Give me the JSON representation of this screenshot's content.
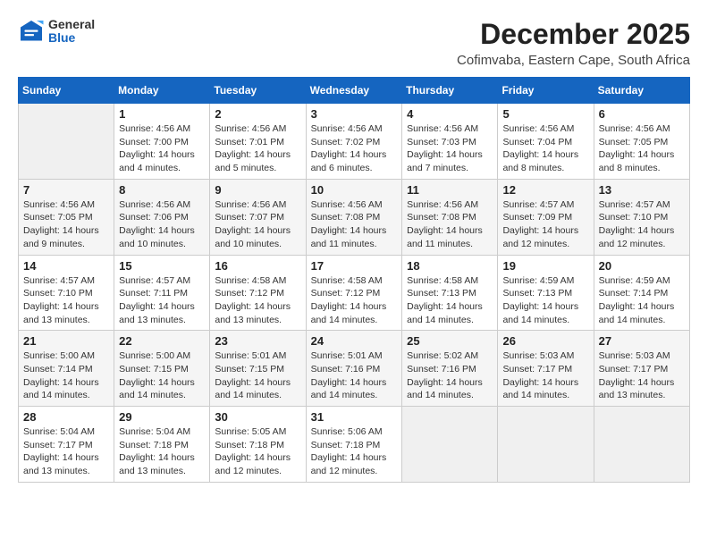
{
  "header": {
    "logo_general": "General",
    "logo_blue": "Blue",
    "title": "December 2025",
    "subtitle": "Cofimvaba, Eastern Cape, South Africa"
  },
  "calendar": {
    "columns": [
      "Sunday",
      "Monday",
      "Tuesday",
      "Wednesday",
      "Thursday",
      "Friday",
      "Saturday"
    ],
    "weeks": [
      [
        {
          "num": "",
          "info": ""
        },
        {
          "num": "1",
          "info": "Sunrise: 4:56 AM\nSunset: 7:00 PM\nDaylight: 14 hours\nand 4 minutes."
        },
        {
          "num": "2",
          "info": "Sunrise: 4:56 AM\nSunset: 7:01 PM\nDaylight: 14 hours\nand 5 minutes."
        },
        {
          "num": "3",
          "info": "Sunrise: 4:56 AM\nSunset: 7:02 PM\nDaylight: 14 hours\nand 6 minutes."
        },
        {
          "num": "4",
          "info": "Sunrise: 4:56 AM\nSunset: 7:03 PM\nDaylight: 14 hours\nand 7 minutes."
        },
        {
          "num": "5",
          "info": "Sunrise: 4:56 AM\nSunset: 7:04 PM\nDaylight: 14 hours\nand 8 minutes."
        },
        {
          "num": "6",
          "info": "Sunrise: 4:56 AM\nSunset: 7:05 PM\nDaylight: 14 hours\nand 8 minutes."
        }
      ],
      [
        {
          "num": "7",
          "info": "Sunrise: 4:56 AM\nSunset: 7:05 PM\nDaylight: 14 hours\nand 9 minutes."
        },
        {
          "num": "8",
          "info": "Sunrise: 4:56 AM\nSunset: 7:06 PM\nDaylight: 14 hours\nand 10 minutes."
        },
        {
          "num": "9",
          "info": "Sunrise: 4:56 AM\nSunset: 7:07 PM\nDaylight: 14 hours\nand 10 minutes."
        },
        {
          "num": "10",
          "info": "Sunrise: 4:56 AM\nSunset: 7:08 PM\nDaylight: 14 hours\nand 11 minutes."
        },
        {
          "num": "11",
          "info": "Sunrise: 4:56 AM\nSunset: 7:08 PM\nDaylight: 14 hours\nand 11 minutes."
        },
        {
          "num": "12",
          "info": "Sunrise: 4:57 AM\nSunset: 7:09 PM\nDaylight: 14 hours\nand 12 minutes."
        },
        {
          "num": "13",
          "info": "Sunrise: 4:57 AM\nSunset: 7:10 PM\nDaylight: 14 hours\nand 12 minutes."
        }
      ],
      [
        {
          "num": "14",
          "info": "Sunrise: 4:57 AM\nSunset: 7:10 PM\nDaylight: 14 hours\nand 13 minutes."
        },
        {
          "num": "15",
          "info": "Sunrise: 4:57 AM\nSunset: 7:11 PM\nDaylight: 14 hours\nand 13 minutes."
        },
        {
          "num": "16",
          "info": "Sunrise: 4:58 AM\nSunset: 7:12 PM\nDaylight: 14 hours\nand 13 minutes."
        },
        {
          "num": "17",
          "info": "Sunrise: 4:58 AM\nSunset: 7:12 PM\nDaylight: 14 hours\nand 14 minutes."
        },
        {
          "num": "18",
          "info": "Sunrise: 4:58 AM\nSunset: 7:13 PM\nDaylight: 14 hours\nand 14 minutes."
        },
        {
          "num": "19",
          "info": "Sunrise: 4:59 AM\nSunset: 7:13 PM\nDaylight: 14 hours\nand 14 minutes."
        },
        {
          "num": "20",
          "info": "Sunrise: 4:59 AM\nSunset: 7:14 PM\nDaylight: 14 hours\nand 14 minutes."
        }
      ],
      [
        {
          "num": "21",
          "info": "Sunrise: 5:00 AM\nSunset: 7:14 PM\nDaylight: 14 hours\nand 14 minutes."
        },
        {
          "num": "22",
          "info": "Sunrise: 5:00 AM\nSunset: 7:15 PM\nDaylight: 14 hours\nand 14 minutes."
        },
        {
          "num": "23",
          "info": "Sunrise: 5:01 AM\nSunset: 7:15 PM\nDaylight: 14 hours\nand 14 minutes."
        },
        {
          "num": "24",
          "info": "Sunrise: 5:01 AM\nSunset: 7:16 PM\nDaylight: 14 hours\nand 14 minutes."
        },
        {
          "num": "25",
          "info": "Sunrise: 5:02 AM\nSunset: 7:16 PM\nDaylight: 14 hours\nand 14 minutes."
        },
        {
          "num": "26",
          "info": "Sunrise: 5:03 AM\nSunset: 7:17 PM\nDaylight: 14 hours\nand 14 minutes."
        },
        {
          "num": "27",
          "info": "Sunrise: 5:03 AM\nSunset: 7:17 PM\nDaylight: 14 hours\nand 13 minutes."
        }
      ],
      [
        {
          "num": "28",
          "info": "Sunrise: 5:04 AM\nSunset: 7:17 PM\nDaylight: 14 hours\nand 13 minutes."
        },
        {
          "num": "29",
          "info": "Sunrise: 5:04 AM\nSunset: 7:18 PM\nDaylight: 14 hours\nand 13 minutes."
        },
        {
          "num": "30",
          "info": "Sunrise: 5:05 AM\nSunset: 7:18 PM\nDaylight: 14 hours\nand 12 minutes."
        },
        {
          "num": "31",
          "info": "Sunrise: 5:06 AM\nSunset: 7:18 PM\nDaylight: 14 hours\nand 12 minutes."
        },
        {
          "num": "",
          "info": ""
        },
        {
          "num": "",
          "info": ""
        },
        {
          "num": "",
          "info": ""
        }
      ]
    ]
  }
}
